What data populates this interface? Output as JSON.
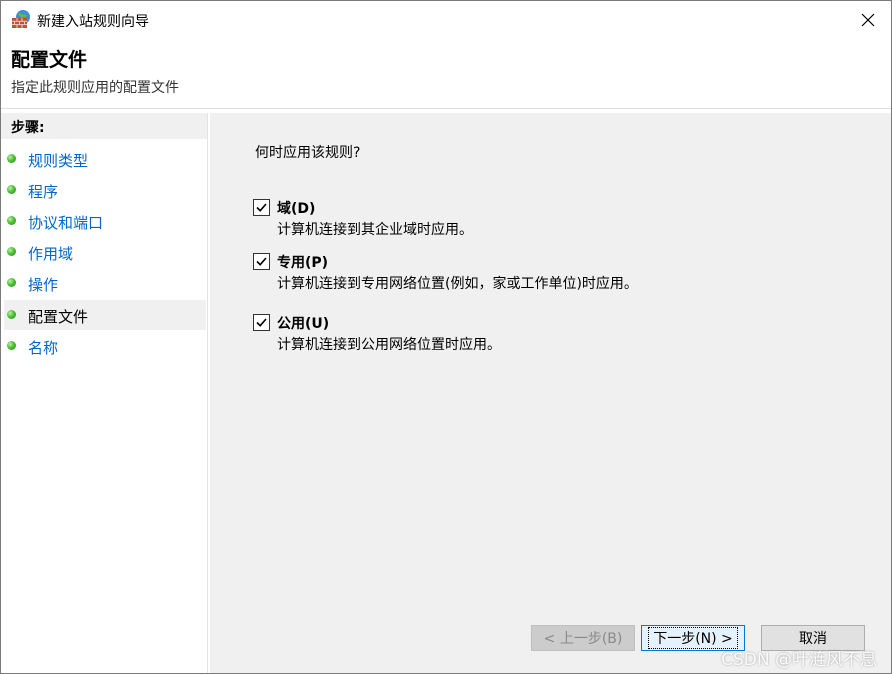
{
  "window": {
    "title": "新建入站规则向导",
    "icon": "firewall-icon"
  },
  "header": {
    "title": "配置文件",
    "subtitle": "指定此规则应用的配置文件"
  },
  "sidebar": {
    "heading": "步骤:",
    "items": [
      {
        "label": "规则类型",
        "current": false
      },
      {
        "label": "程序",
        "current": false
      },
      {
        "label": "协议和端口",
        "current": false
      },
      {
        "label": "作用域",
        "current": false
      },
      {
        "label": "操作",
        "current": false
      },
      {
        "label": "配置文件",
        "current": true
      },
      {
        "label": "名称",
        "current": false
      }
    ]
  },
  "main": {
    "question": "何时应用该规则?",
    "options": [
      {
        "label": "域(D)",
        "description": "计算机连接到其企业域时应用。",
        "checked": true
      },
      {
        "label": "专用(P)",
        "description": "计算机连接到专用网络位置(例如，家或工作单位)时应用。",
        "checked": true
      },
      {
        "label": "公用(U)",
        "description": "计算机连接到公用网络位置时应用。",
        "checked": true
      }
    ]
  },
  "buttons": {
    "back": "< 上一步(B)",
    "next": "下一步(N) >",
    "cancel": "取消"
  },
  "watermark": "CSDN @叶涟风不息",
  "colors": {
    "link": "#0066cc",
    "panel_bg": "#f0f0f0",
    "primary_border": "#0078d7"
  }
}
